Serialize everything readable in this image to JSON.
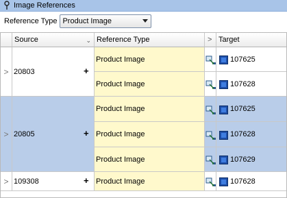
{
  "panel": {
    "title": "Image References"
  },
  "toolbar": {
    "reference_type_label": "Reference Type",
    "reference_type_value": "Product Image"
  },
  "columns": {
    "source": "Source",
    "reference_type": "Reference Type",
    "target": "Target",
    "expand_glyph": ">"
  },
  "groups": [
    {
      "source": "20803",
      "rows": [
        {
          "reference_type": "Product Image",
          "target": "107625"
        },
        {
          "reference_type": "Product Image",
          "target": "107628"
        }
      ]
    },
    {
      "source": "20805",
      "rows": [
        {
          "reference_type": "Product Image",
          "target": "107625"
        },
        {
          "reference_type": "Product Image",
          "target": "107628"
        },
        {
          "reference_type": "Product Image",
          "target": "107629"
        }
      ]
    },
    {
      "source": "109308",
      "rows": [
        {
          "reference_type": "Product Image",
          "target": "107628"
        }
      ]
    }
  ],
  "colors": {
    "title_bar": "#a8c4e8",
    "selected_row": "#b9cde9",
    "reference_cell": "#fff9cc"
  },
  "icons": {
    "pin": "pin-icon",
    "link": "link-cursor-icon",
    "image": "image-icon",
    "add": "plus-icon",
    "expand": "chevron-right-icon"
  }
}
